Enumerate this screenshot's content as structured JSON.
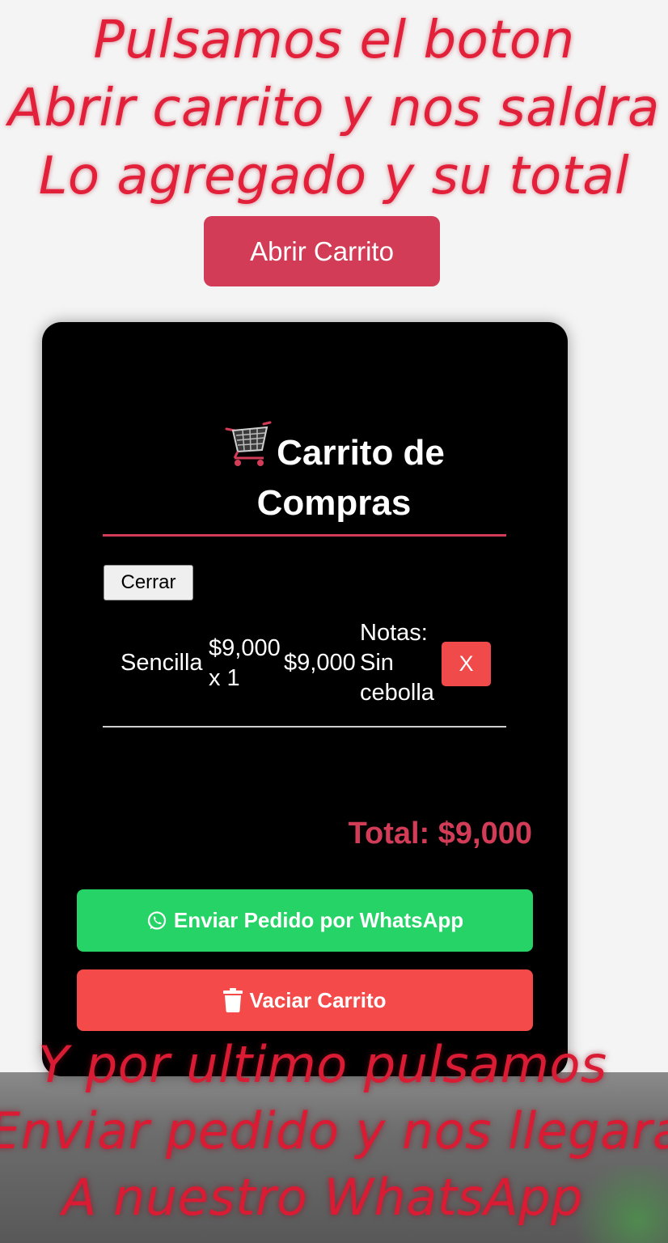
{
  "caption_top": {
    "lines": [
      "Pulsamos el boton",
      "Abrir carrito y nos saldra",
      "Lo agregado y su total"
    ]
  },
  "caption_bottom": {
    "lines": [
      "Y por ultimo pulsamos",
      "Enviar pedido y nos llegara",
      "A nuestro WhatsApp"
    ]
  },
  "open_cart_button": {
    "label": "Abrir Carrito"
  },
  "cart_modal": {
    "title_line1": "Carrito de",
    "title_line2": "Compras",
    "title_icon": "shopping-cart-icon",
    "close_label": "Cerrar",
    "items": [
      {
        "name": "Sencilla",
        "unit_price": "$9,000",
        "quantity_text": "x 1",
        "subtotal": "$9,000",
        "notes_label": "Notas:",
        "notes_line1": "Sin",
        "notes_line2": "cebolla",
        "remove_label": "X"
      }
    ],
    "total_text": "Total: $9,000",
    "whatsapp_button_label": "Enviar Pedido por WhatsApp",
    "whatsapp_icon": "whatsapp-icon",
    "empty_button_label": "Vaciar Carrito",
    "empty_icon": "trash-icon"
  },
  "colors": {
    "accent": "#d23c57",
    "whatsapp_green": "#25d366",
    "danger_red": "#f44a4a",
    "caption_red": "#e2203a",
    "modal_bg": "#000000"
  }
}
